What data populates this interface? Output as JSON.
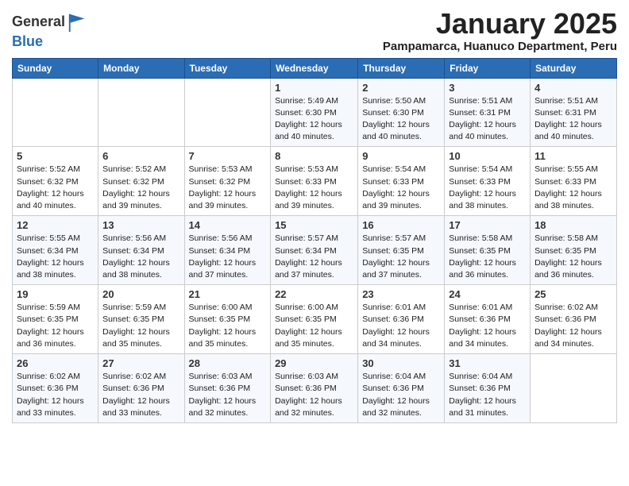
{
  "logo": {
    "general": "General",
    "blue": "Blue"
  },
  "title": "January 2025",
  "subtitle": "Pampamarca, Huanuco Department, Peru",
  "days_of_week": [
    "Sunday",
    "Monday",
    "Tuesday",
    "Wednesday",
    "Thursday",
    "Friday",
    "Saturday"
  ],
  "weeks": [
    [
      {
        "day": "",
        "info": ""
      },
      {
        "day": "",
        "info": ""
      },
      {
        "day": "",
        "info": ""
      },
      {
        "day": "1",
        "info": "Sunrise: 5:49 AM\nSunset: 6:30 PM\nDaylight: 12 hours\nand 40 minutes."
      },
      {
        "day": "2",
        "info": "Sunrise: 5:50 AM\nSunset: 6:30 PM\nDaylight: 12 hours\nand 40 minutes."
      },
      {
        "day": "3",
        "info": "Sunrise: 5:51 AM\nSunset: 6:31 PM\nDaylight: 12 hours\nand 40 minutes."
      },
      {
        "day": "4",
        "info": "Sunrise: 5:51 AM\nSunset: 6:31 PM\nDaylight: 12 hours\nand 40 minutes."
      }
    ],
    [
      {
        "day": "5",
        "info": "Sunrise: 5:52 AM\nSunset: 6:32 PM\nDaylight: 12 hours\nand 40 minutes."
      },
      {
        "day": "6",
        "info": "Sunrise: 5:52 AM\nSunset: 6:32 PM\nDaylight: 12 hours\nand 39 minutes."
      },
      {
        "day": "7",
        "info": "Sunrise: 5:53 AM\nSunset: 6:32 PM\nDaylight: 12 hours\nand 39 minutes."
      },
      {
        "day": "8",
        "info": "Sunrise: 5:53 AM\nSunset: 6:33 PM\nDaylight: 12 hours\nand 39 minutes."
      },
      {
        "day": "9",
        "info": "Sunrise: 5:54 AM\nSunset: 6:33 PM\nDaylight: 12 hours\nand 39 minutes."
      },
      {
        "day": "10",
        "info": "Sunrise: 5:54 AM\nSunset: 6:33 PM\nDaylight: 12 hours\nand 38 minutes."
      },
      {
        "day": "11",
        "info": "Sunrise: 5:55 AM\nSunset: 6:33 PM\nDaylight: 12 hours\nand 38 minutes."
      }
    ],
    [
      {
        "day": "12",
        "info": "Sunrise: 5:55 AM\nSunset: 6:34 PM\nDaylight: 12 hours\nand 38 minutes."
      },
      {
        "day": "13",
        "info": "Sunrise: 5:56 AM\nSunset: 6:34 PM\nDaylight: 12 hours\nand 38 minutes."
      },
      {
        "day": "14",
        "info": "Sunrise: 5:56 AM\nSunset: 6:34 PM\nDaylight: 12 hours\nand 37 minutes."
      },
      {
        "day": "15",
        "info": "Sunrise: 5:57 AM\nSunset: 6:34 PM\nDaylight: 12 hours\nand 37 minutes."
      },
      {
        "day": "16",
        "info": "Sunrise: 5:57 AM\nSunset: 6:35 PM\nDaylight: 12 hours\nand 37 minutes."
      },
      {
        "day": "17",
        "info": "Sunrise: 5:58 AM\nSunset: 6:35 PM\nDaylight: 12 hours\nand 36 minutes."
      },
      {
        "day": "18",
        "info": "Sunrise: 5:58 AM\nSunset: 6:35 PM\nDaylight: 12 hours\nand 36 minutes."
      }
    ],
    [
      {
        "day": "19",
        "info": "Sunrise: 5:59 AM\nSunset: 6:35 PM\nDaylight: 12 hours\nand 36 minutes."
      },
      {
        "day": "20",
        "info": "Sunrise: 5:59 AM\nSunset: 6:35 PM\nDaylight: 12 hours\nand 35 minutes."
      },
      {
        "day": "21",
        "info": "Sunrise: 6:00 AM\nSunset: 6:35 PM\nDaylight: 12 hours\nand 35 minutes."
      },
      {
        "day": "22",
        "info": "Sunrise: 6:00 AM\nSunset: 6:35 PM\nDaylight: 12 hours\nand 35 minutes."
      },
      {
        "day": "23",
        "info": "Sunrise: 6:01 AM\nSunset: 6:36 PM\nDaylight: 12 hours\nand 34 minutes."
      },
      {
        "day": "24",
        "info": "Sunrise: 6:01 AM\nSunset: 6:36 PM\nDaylight: 12 hours\nand 34 minutes."
      },
      {
        "day": "25",
        "info": "Sunrise: 6:02 AM\nSunset: 6:36 PM\nDaylight: 12 hours\nand 34 minutes."
      }
    ],
    [
      {
        "day": "26",
        "info": "Sunrise: 6:02 AM\nSunset: 6:36 PM\nDaylight: 12 hours\nand 33 minutes."
      },
      {
        "day": "27",
        "info": "Sunrise: 6:02 AM\nSunset: 6:36 PM\nDaylight: 12 hours\nand 33 minutes."
      },
      {
        "day": "28",
        "info": "Sunrise: 6:03 AM\nSunset: 6:36 PM\nDaylight: 12 hours\nand 32 minutes."
      },
      {
        "day": "29",
        "info": "Sunrise: 6:03 AM\nSunset: 6:36 PM\nDaylight: 12 hours\nand 32 minutes."
      },
      {
        "day": "30",
        "info": "Sunrise: 6:04 AM\nSunset: 6:36 PM\nDaylight: 12 hours\nand 32 minutes."
      },
      {
        "day": "31",
        "info": "Sunrise: 6:04 AM\nSunset: 6:36 PM\nDaylight: 12 hours\nand 31 minutes."
      },
      {
        "day": "",
        "info": ""
      }
    ]
  ]
}
